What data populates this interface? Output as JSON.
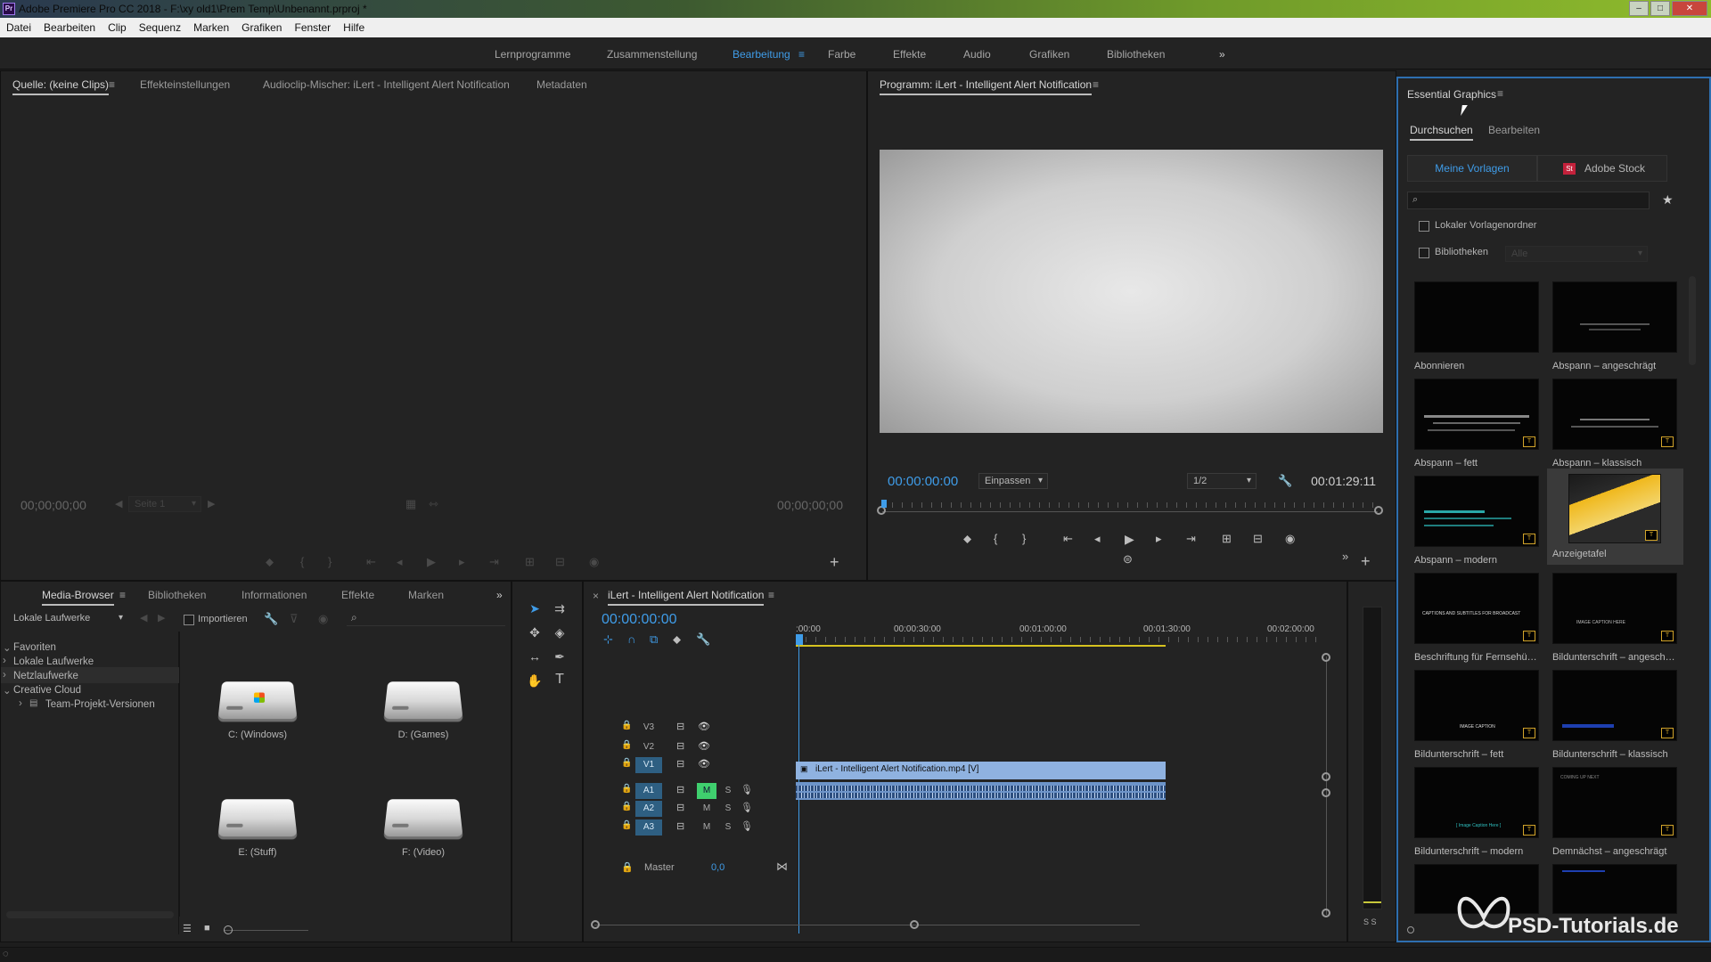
{
  "app": {
    "title": "Adobe Premiere Pro CC 2018 - F:\\xy old1\\Prem Temp\\Unbenannt.prproj *",
    "icon_label": "Pr"
  },
  "menu": [
    "Datei",
    "Bearbeiten",
    "Clip",
    "Sequenz",
    "Marken",
    "Grafiken",
    "Fenster",
    "Hilfe"
  ],
  "workspaces": {
    "items": [
      "Lernprogramme",
      "Zusammenstellung",
      "Bearbeitung",
      "Farbe",
      "Effekte",
      "Audio",
      "Grafiken",
      "Bibliotheken"
    ],
    "active": "Bearbeitung",
    "overflow": "»"
  },
  "source_panel": {
    "tabs": [
      "Quelle: (keine Clips)",
      "Effekteinstellungen",
      "Audioclip-Mischer: iLert - Intelligent Alert Notification",
      "Metadaten"
    ],
    "timecode_left": "00;00;00;00",
    "timecode_right": "00;00;00;00",
    "page_select": "Seite 1"
  },
  "program_panel": {
    "title": "Programm: iLert - Intelligent Alert Notification",
    "timecode": "00:00:00:00",
    "zoom": "Einpassen",
    "resolution": "1/2",
    "duration": "00:01:29:11"
  },
  "essential_graphics": {
    "title": "Essential Graphics",
    "tabs": [
      "Durchsuchen",
      "Bearbeiten"
    ],
    "active_tab": "Durchsuchen",
    "source_buttons": [
      "Meine Vorlagen",
      "Adobe Stock"
    ],
    "stock_icon": "St",
    "checkbox_local": "Lokaler Vorlagenordner",
    "checkbox_libs": "Bibliotheken",
    "libs_select": "Alle",
    "templates": [
      "Abonnieren",
      "Abspann – angeschrägt",
      "Abspann – fett",
      "Abspann – klassisch",
      "Abspann – modern",
      "Anzeigetafel",
      "Beschriftung für Fernsehübertragung",
      "Bildunterschrift – angeschrägt",
      "Bildunterschrift – fett",
      "Bildunterschrift – klassisch",
      "Bildunterschrift – modern",
      "Demnächst – angeschrägt"
    ],
    "thumb_texts": {
      "broadcast": "CAPTIONS AND SUBTITLES FOR BROADCAST",
      "angled": "IMAGE CAPTION HERE",
      "bold": "IMAGE CAPTION",
      "modern": "[ Image Caption Here ]",
      "coming": "COMING UP NEXT"
    }
  },
  "media_browser": {
    "tabs": [
      "Media-Browser",
      "Bibliotheken",
      "Informationen",
      "Effekte",
      "Marken"
    ],
    "location": "Lokale Laufwerke",
    "import_label": "Importieren",
    "tree": [
      {
        "label": "Favoriten",
        "indent": 0,
        "arrow": "⌄"
      },
      {
        "label": "Lokale Laufwerke",
        "indent": 0,
        "arrow": "›"
      },
      {
        "label": "Netzlaufwerke",
        "indent": 0,
        "arrow": "›"
      },
      {
        "label": "Creative Cloud",
        "indent": 0,
        "arrow": "⌄"
      },
      {
        "label": "Team-Projekt-Versionen",
        "indent": 1,
        "arrow": "›"
      }
    ],
    "drives": [
      "C: (Windows)",
      "D: (Games)",
      "E: (Stuff)",
      "F: (Video)"
    ]
  },
  "timeline": {
    "title": "iLert - Intelligent Alert Notification",
    "timecode": "00:00:00:00",
    "ruler": [
      ":00:00",
      "00:00:30:00",
      "00:01:00:00",
      "00:01:30:00",
      "00:02:00:00"
    ],
    "video_tracks": [
      "V3",
      "V2",
      "V1"
    ],
    "audio_tracks": [
      "A1",
      "A2",
      "A3"
    ],
    "master_label": "Master",
    "master_value": "0,0",
    "clip_name": "iLert - Intelligent Alert Notification.mp4 [V]",
    "m": "M",
    "s": "S"
  },
  "meter_labels": "S S",
  "watermark": "PSD-Tutorials.de"
}
